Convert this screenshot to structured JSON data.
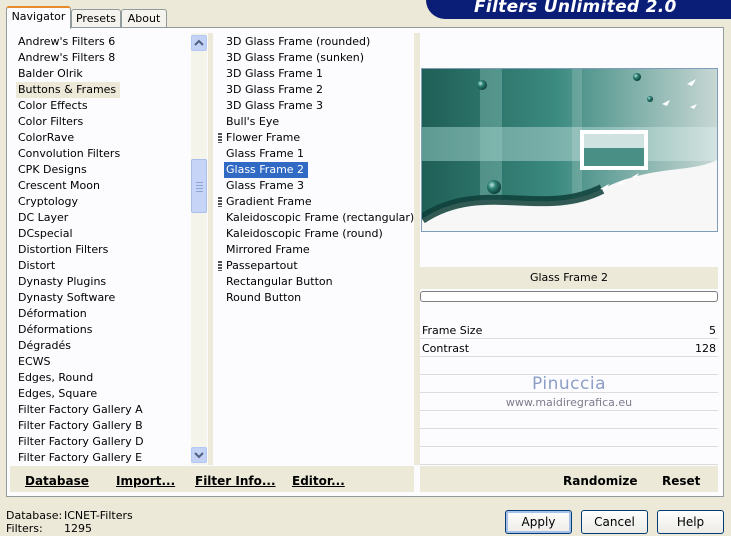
{
  "tabs": [
    "Navigator",
    "Presets",
    "About"
  ],
  "banner_title": "Filters Unlimited 2.0",
  "categories": [
    "Andrew's Filters 6",
    "Andrew's Filters 8",
    "Balder Olrik",
    "Buttons & Frames",
    "Color Effects",
    "Color Filters",
    "ColorRave",
    "Convolution Filters",
    "CPK Designs",
    "Crescent Moon",
    "Cryptology",
    "DC Layer",
    "DCspecial",
    "Distortion Filters",
    "Distort",
    "Dynasty Plugins",
    "Dynasty Software",
    "Déformation",
    "Déformations",
    "Dégradés",
    "ECWS",
    "Edges, Round",
    "Edges, Square",
    "Filter Factory Gallery A",
    "Filter Factory Gallery B",
    "Filter Factory Gallery D",
    "Filter Factory Gallery E"
  ],
  "selected_category": "Buttons & Frames",
  "filters": [
    "3D Glass Frame (rounded)",
    "3D Glass Frame (sunken)",
    "3D Glass Frame 1",
    "3D Glass Frame 2",
    "3D Glass Frame 3",
    "Bull's Eye",
    "Flower Frame",
    "Glass Frame 1",
    "Glass Frame 2",
    "Glass Frame 3",
    "Gradient Frame",
    "Kaleidoscopic Frame (rectangular)",
    "Kaleidoscopic Frame (round)",
    "Mirrored Frame",
    "Passepartout",
    "Rectangular Button",
    "Round Button"
  ],
  "selected_filter": "Glass Frame 2",
  "filter_name_display": "Glass Frame 2",
  "params": [
    {
      "label": "Frame Size",
      "value": "5"
    },
    {
      "label": "Contrast",
      "value": "128"
    }
  ],
  "watermark": {
    "line1": "Pinuccia",
    "line2": "www.maidiregrafica.eu"
  },
  "bottom_links": {
    "database": "Database",
    "import": "Import...",
    "filter_info": "Filter Info...",
    "editor": "Editor...",
    "randomize": "Randomize",
    "reset": "Reset"
  },
  "status": {
    "database_label": "Database:",
    "database_value": "ICNET-Filters",
    "filters_label": "Filters:",
    "filters_value": "1295"
  },
  "buttons": {
    "apply": "Apply",
    "cancel": "Cancel",
    "help": "Help"
  },
  "colors": {
    "accent": "#316ac5",
    "banner": "#0a1e78",
    "tab_highlight": "#e68b2c"
  }
}
